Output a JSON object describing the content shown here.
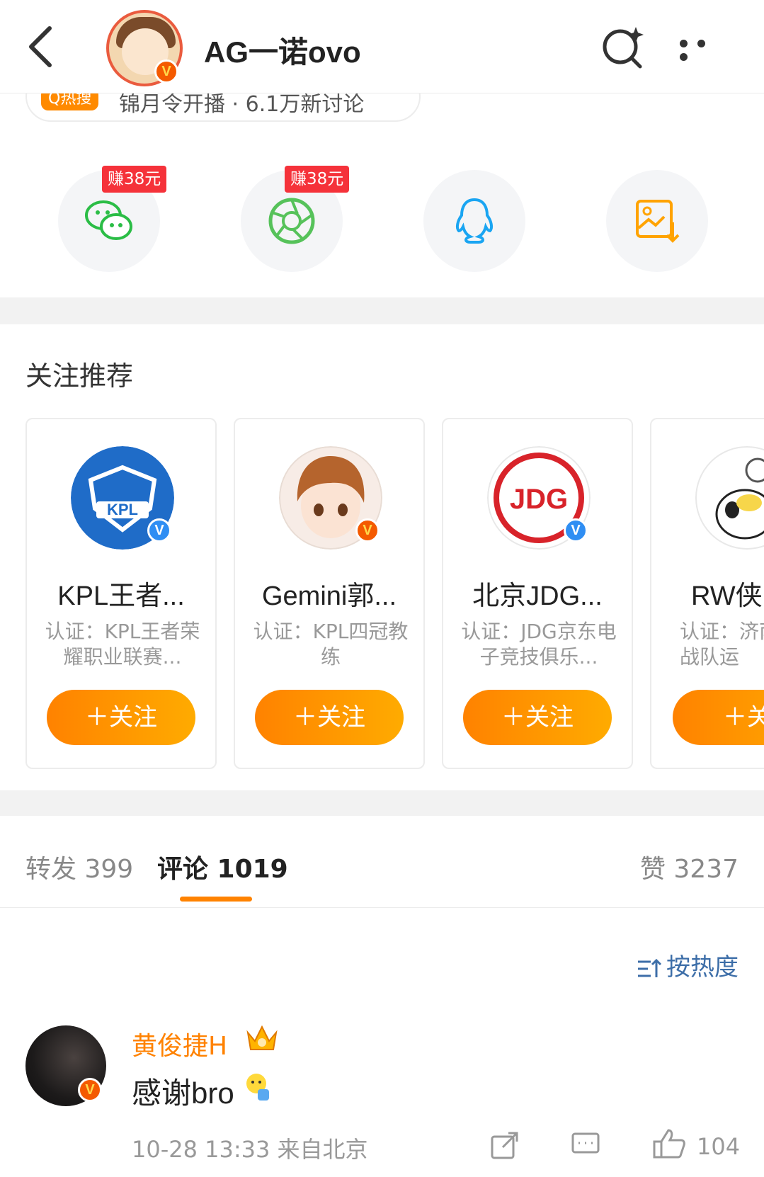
{
  "header": {
    "title": "AG一诺ovo",
    "avatar_badge": "V"
  },
  "trend": {
    "tag": "Q热搜",
    "text": "锦月令开播 · 6.1万新讨论"
  },
  "share": {
    "items": [
      {
        "name": "wechat",
        "badge": "赚38元",
        "color": "#2bbd46"
      },
      {
        "name": "moments",
        "badge": "赚38元",
        "color": "#56c25a"
      },
      {
        "name": "qq",
        "badge": "",
        "color": "#1aa5f2"
      },
      {
        "name": "save-image",
        "badge": "",
        "color": "#ffa300"
      }
    ]
  },
  "recommend": {
    "title": "关注推荐",
    "cards": [
      {
        "name": "KPL王者...",
        "desc": "认证：KPL王者荣耀职业联赛...",
        "button": "＋关注",
        "badge": "V"
      },
      {
        "name": "Gemini郭...",
        "desc": "认证：KPL四冠教练",
        "button": "＋关注",
        "badge": "V"
      },
      {
        "name": "北京JDG...",
        "desc": "认证：JDG京东电子竞技俱乐...",
        "button": "＋关注",
        "badge": "V"
      },
      {
        "name": "RW侠",
        "desc": "认证：济南RW侠战队运",
        "button": "＋关",
        "badge": ""
      }
    ]
  },
  "tabs": {
    "repost": "转发 399",
    "comment": "评论 1019",
    "like": "赞 3237"
  },
  "sort": {
    "label": "按热度"
  },
  "comment": {
    "user": "黄俊捷H",
    "text": "感谢bro",
    "meta": "10-28 13:33  来自北京",
    "like_count": "104",
    "badge": "V"
  },
  "colors": {
    "accent": "#ff8200",
    "link": "#3d6ea8",
    "badge_red": "#f5323a"
  }
}
